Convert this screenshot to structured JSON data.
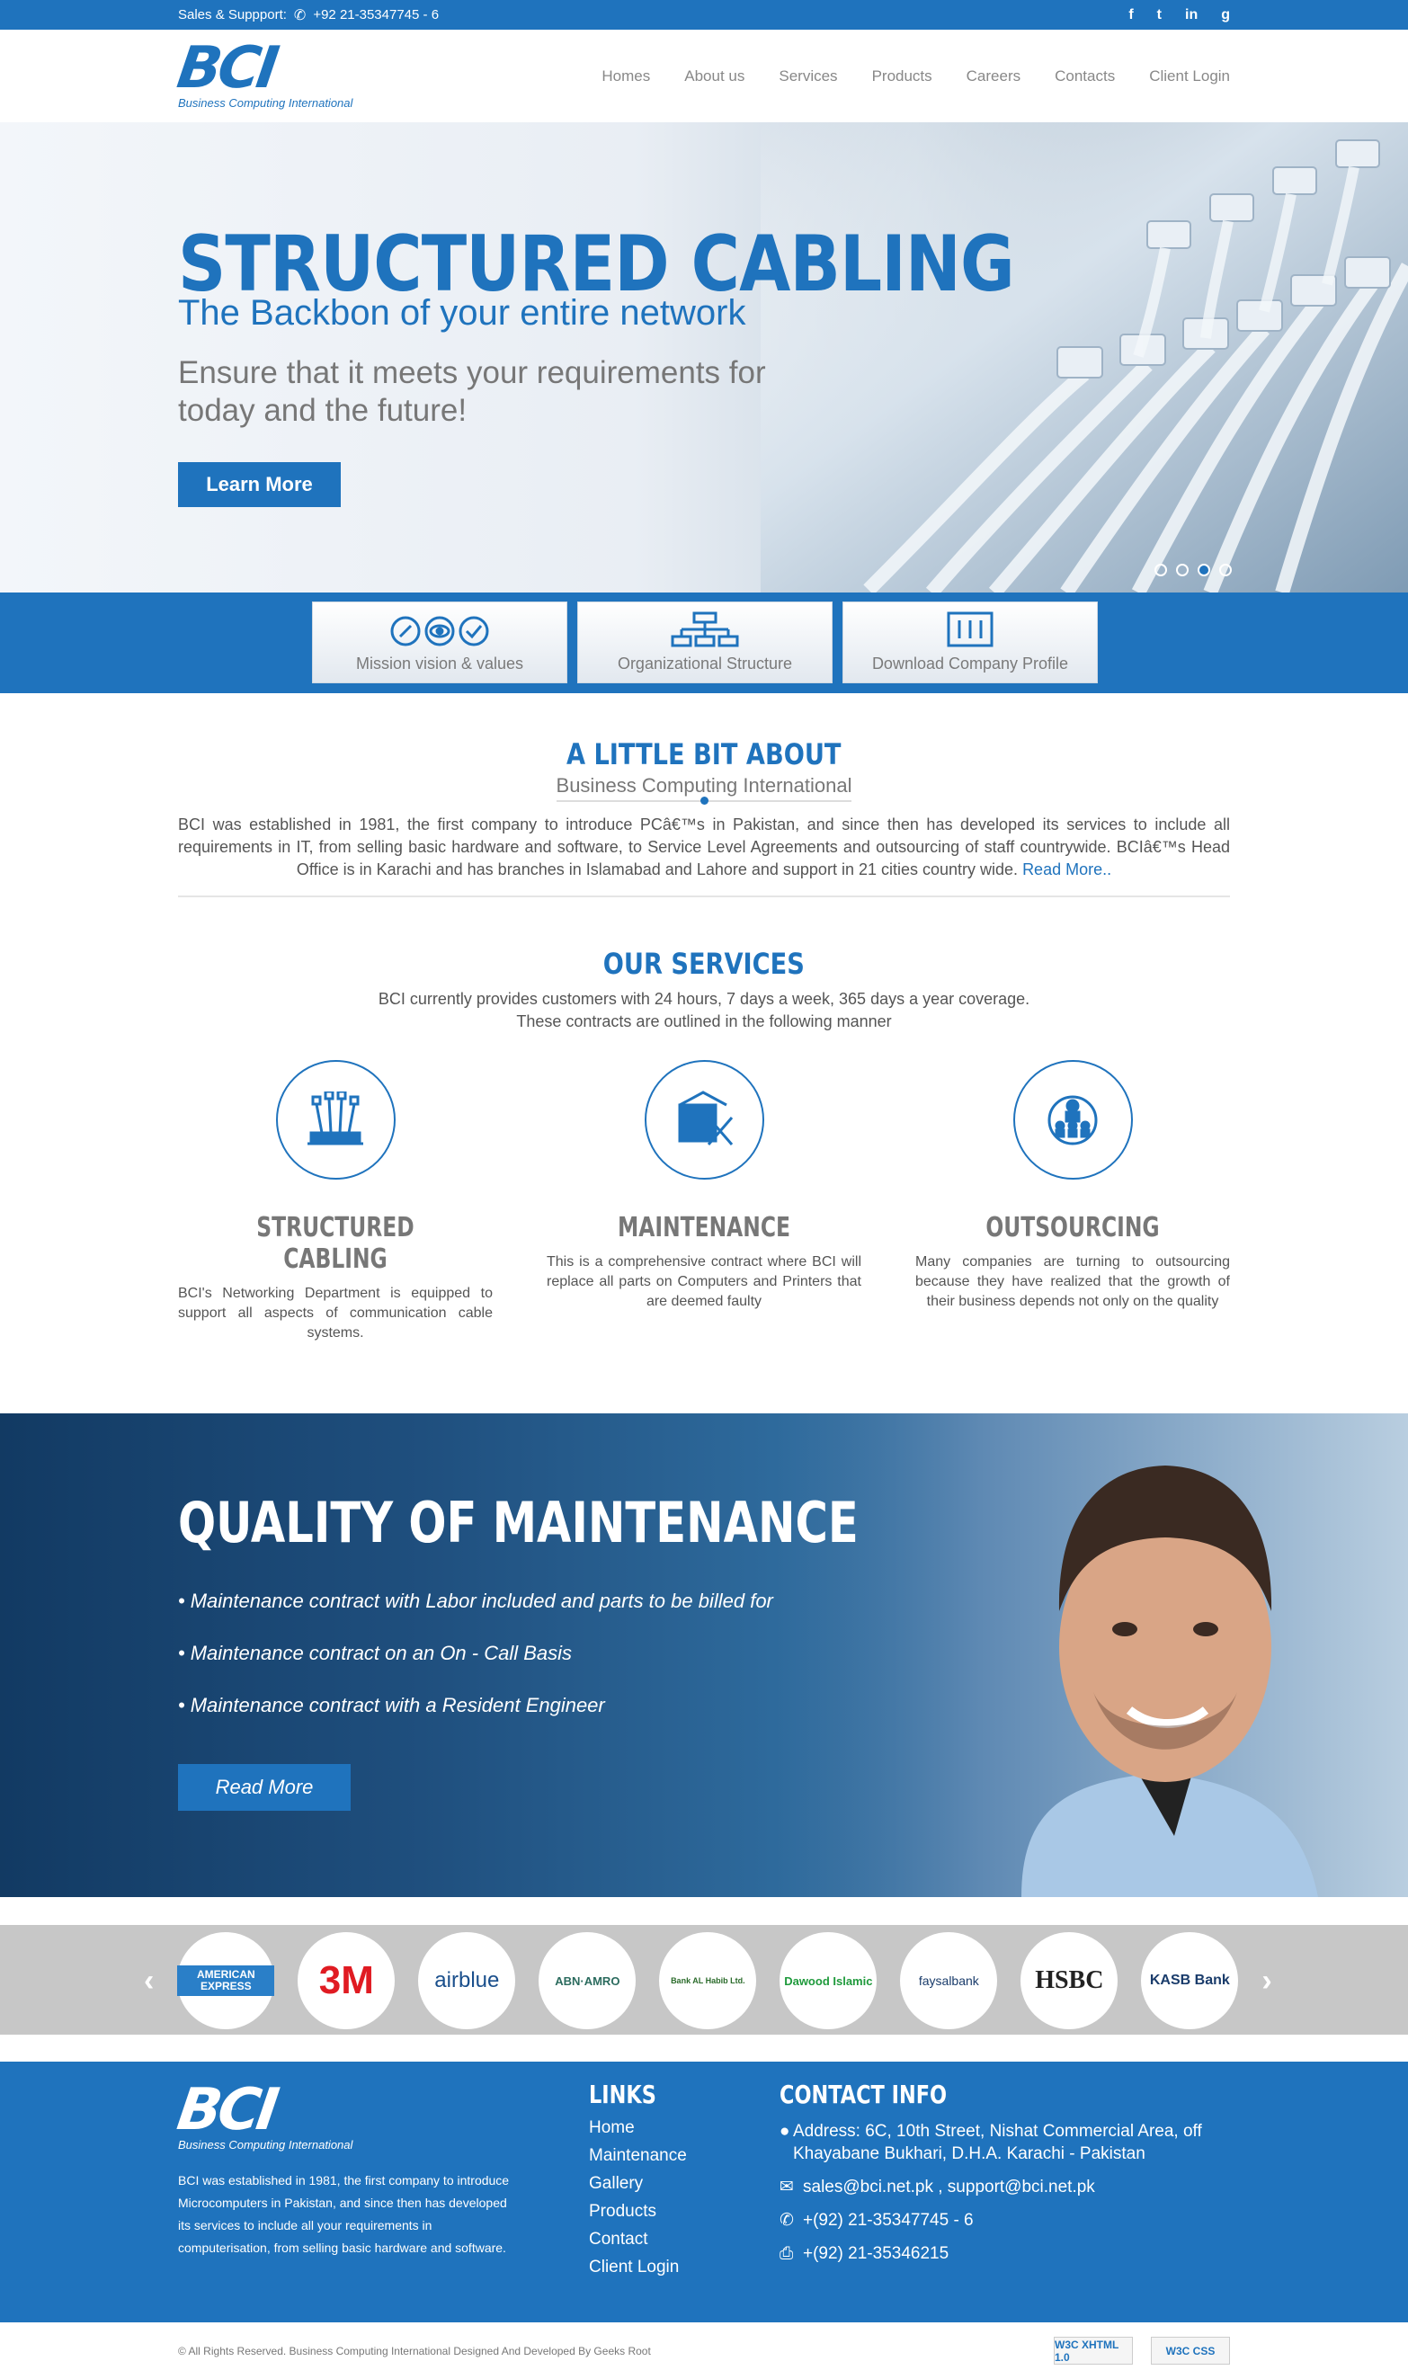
{
  "topbar": {
    "label": "Sales & Suppport:",
    "phone": "+92 21-35347745 - 6",
    "social": [
      "f",
      "t",
      "in",
      "g"
    ]
  },
  "header": {
    "logo_mark": "BCI",
    "logo_tag": "Business Computing International",
    "nav": [
      "Homes",
      "About us",
      "Services",
      "Products",
      "Careers",
      "Contacts",
      "Client Login"
    ]
  },
  "hero": {
    "title": "STRUCTURED CABLING",
    "subtitle": "The Backbon of your entire network",
    "description": "Ensure that it meets your requirements for today and the future!",
    "button": "Learn More"
  },
  "features": [
    "Mission vision & values",
    "Organizational Structure",
    "Download Company Profile"
  ],
  "about": {
    "title": "A LITTLE BIT ABOUT",
    "subtitle": "Business Computing International",
    "text": "BCI was established in 1981, the first company to introduce PCâ€™s in Pakistan, and since then has developed its services to include all requirements in IT, from selling basic hardware and software, to Service Level Agreements and outsourcing of staff countrywide. BCIâ€™s Head Office is in Karachi and has branches in Islamabad and Lahore and support in 21 cities country wide.",
    "read_more": "Read More.."
  },
  "services": {
    "title": "OUR SERVICES",
    "intro_line1": "BCI currently provides customers with 24 hours, 7 days a week, 365 days a year coverage.",
    "intro_line2": "These contracts are outlined in the following manner",
    "items": [
      {
        "title": "STRUCTURED CABLING",
        "text": "BCI's Networking Department is equipped to support all aspects of communication cable systems."
      },
      {
        "title": "MAINTENANCE",
        "text": "This is a comprehensive contract where BCI will replace all parts on Computers and Printers that are deemed faulty"
      },
      {
        "title": "OUTSOURCING",
        "text": "Many companies are turning to outsourcing because they have realized that the growth of their business depends not only on the quality"
      }
    ]
  },
  "quality": {
    "title": "QUALITY OF MAINTENANCE",
    "bullets": [
      "Maintenance contract with Labor included and parts to be billed for",
      "Maintenance contract on an On - Call Basis",
      "Maintenance contract with a Resident Engineer"
    ],
    "button": "Read More"
  },
  "clients": {
    "prev": "‹",
    "next": "›",
    "logos": [
      "AMERICAN EXPRESS",
      "3M",
      "airblue",
      "ABN·AMRO",
      "Bank AL Habib Ltd.",
      "Dawood Islamic",
      "faysalbank",
      "HSBC",
      "KASB Bank"
    ]
  },
  "footer": {
    "logo_mark": "BCI",
    "logo_tag": "Business Computing International",
    "about": "BCI was established in 1981, the first company to introduce Microcomputers in Pakistan, and since then has developed its services to include all your requirements in computerisation, from selling basic hardware and software.",
    "links_title": "LINKS",
    "links": [
      "Home",
      "Maintenance",
      "Gallery",
      "Products",
      "Contact",
      "Client Login"
    ],
    "contact_title": "CONTACT INFO",
    "address": "Address: 6C, 10th Street, Nishat Commercial Area, off Khayabane Bukhari, D.H.A. Karachi - Pakistan",
    "email": "sales@bci.net.pk , support@bci.net.pk",
    "phone": "+(92) 21-35347745 - 6",
    "fax": "+(92) 21-35346215",
    "copyright": "© All Rights Reserved. Business Computing International Designed And Developed By Geeks Root",
    "badge1": "W3C XHTML 1.0",
    "badge2": "W3C CSS"
  },
  "colors": {
    "brand": "#1f73bd",
    "band": "#1f73bd",
    "clients_bg": "#c7c7c7"
  }
}
